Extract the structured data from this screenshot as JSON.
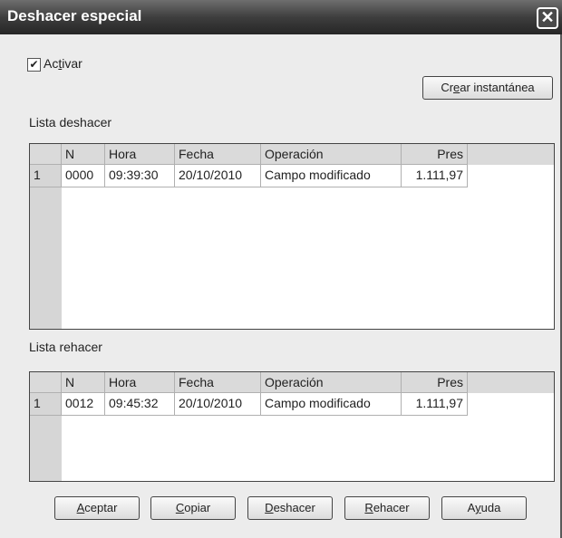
{
  "window": {
    "title": "Deshacer especial"
  },
  "checkbox": {
    "label_pre": "Ac",
    "label_u": "t",
    "label_post": "ivar",
    "checked": true
  },
  "snapshot_button": {
    "pre": "Cr",
    "u": "e",
    "post": "ar instantánea"
  },
  "undo": {
    "title": "Lista deshacer",
    "columns": [
      "N",
      "Hora",
      "Fecha",
      "Operación",
      "Pres"
    ],
    "rows": [
      {
        "index": "1",
        "n": "0000",
        "hora": "09:39:30",
        "fecha": "20/10/2010",
        "op": "Campo modificado",
        "pres": "1.111,97"
      }
    ]
  },
  "redo": {
    "title": "Lista rehacer",
    "columns": [
      "N",
      "Hora",
      "Fecha",
      "Operación",
      "Pres"
    ],
    "rows": [
      {
        "index": "1",
        "n": "0012",
        "hora": "09:45:32",
        "fecha": "20/10/2010",
        "op": "Campo modificado",
        "pres": "1.111,97"
      }
    ]
  },
  "buttons": {
    "accept": {
      "u": "A",
      "post": "ceptar"
    },
    "copy": {
      "u": "C",
      "post": "opiar"
    },
    "undo": {
      "u": "D",
      "post": "eshacer"
    },
    "redo": {
      "u": "R",
      "post": "ehacer"
    },
    "help": {
      "pre": "A",
      "u": "y",
      "post": "uda"
    }
  }
}
